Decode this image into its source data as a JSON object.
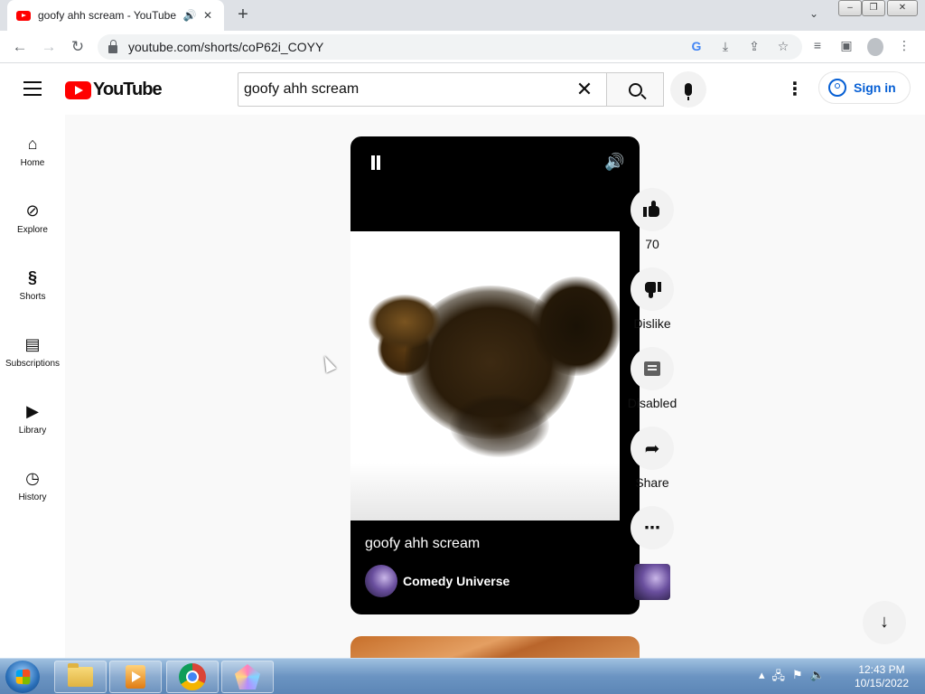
{
  "browser": {
    "tab_title": "goofy ahh scream - YouTube",
    "url": "youtube.com/shorts/coP62i_COYY",
    "new_tab": "+"
  },
  "youtube": {
    "logo_text": "YouTube",
    "search_value": "goofy ahh scream",
    "sign_in": "Sign in"
  },
  "sidebar": {
    "items": [
      {
        "label": "Home",
        "icon": "home-icon"
      },
      {
        "label": "Explore",
        "icon": "compass-icon"
      },
      {
        "label": "Shorts",
        "icon": "shorts-icon"
      },
      {
        "label": "Subscriptions",
        "icon": "subscriptions-icon"
      },
      {
        "label": "Library",
        "icon": "library-icon"
      },
      {
        "label": "History",
        "icon": "history-icon"
      }
    ]
  },
  "short": {
    "title": "goofy ahh scream",
    "channel": "Comedy Universe"
  },
  "actions": {
    "likes": "70",
    "dislike": "Dislike",
    "comments": "Disabled",
    "share": "Share"
  },
  "taskbar": {
    "time": "12:43 PM",
    "date": "10/15/2022"
  },
  "colors": {
    "youtube_red": "#ff0000",
    "link_blue": "#065fd4"
  }
}
